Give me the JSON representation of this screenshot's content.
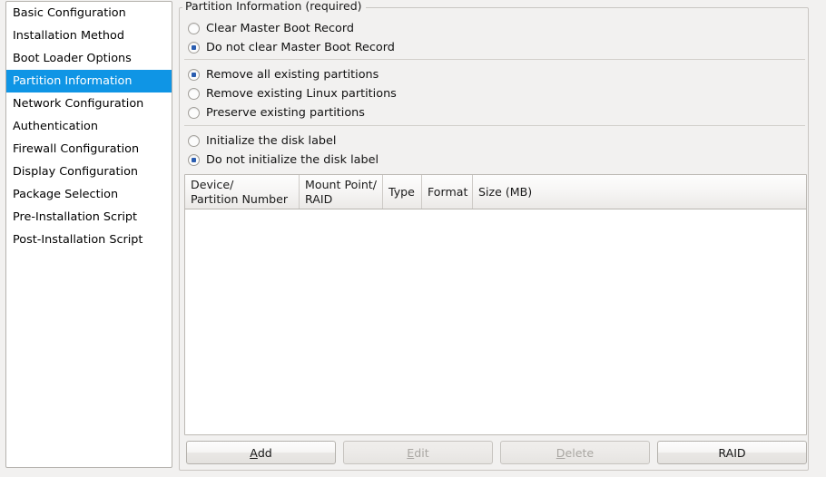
{
  "sidebar": {
    "items": [
      {
        "label": "Basic Configuration",
        "selected": false
      },
      {
        "label": "Installation Method",
        "selected": false
      },
      {
        "label": "Boot Loader Options",
        "selected": false
      },
      {
        "label": "Partition Information",
        "selected": true
      },
      {
        "label": "Network Configuration",
        "selected": false
      },
      {
        "label": "Authentication",
        "selected": false
      },
      {
        "label": "Firewall Configuration",
        "selected": false
      },
      {
        "label": "Display Configuration",
        "selected": false
      },
      {
        "label": "Package Selection",
        "selected": false
      },
      {
        "label": "Pre-Installation Script",
        "selected": false
      },
      {
        "label": "Post-Installation Script",
        "selected": false
      }
    ]
  },
  "panel": {
    "title": "Partition Information (required)",
    "mbr_group": {
      "options": [
        {
          "label": "Clear Master Boot Record",
          "checked": false
        },
        {
          "label": "Do not clear Master Boot Record",
          "checked": true
        }
      ]
    },
    "partition_group": {
      "options": [
        {
          "label": "Remove all existing partitions",
          "checked": true
        },
        {
          "label": "Remove existing Linux partitions",
          "checked": false
        },
        {
          "label": "Preserve existing partitions",
          "checked": false
        }
      ]
    },
    "disklabel_group": {
      "options": [
        {
          "label": "Initialize the disk label",
          "checked": false
        },
        {
          "label": "Do not initialize the disk label",
          "checked": true
        }
      ]
    },
    "table": {
      "columns": [
        {
          "line1": "Device/",
          "line2": "Partition Number"
        },
        {
          "line1": "Mount Point/",
          "line2": "RAID"
        },
        {
          "line1": "Type",
          "line2": ""
        },
        {
          "line1": "Format",
          "line2": ""
        },
        {
          "line1": "Size (MB)",
          "line2": ""
        }
      ],
      "rows": []
    },
    "buttons": [
      {
        "mnemonic": "A",
        "rest": "dd",
        "enabled": true
      },
      {
        "mnemonic": "E",
        "rest": "dit",
        "enabled": false
      },
      {
        "mnemonic": "D",
        "rest": "elete",
        "enabled": false
      },
      {
        "mnemonic": "",
        "rest": "RAID",
        "enabled": true
      }
    ]
  },
  "colors": {
    "selection": "#0f95e5",
    "radio_dot": "#2a5db0",
    "window_bg": "#f2f1f0"
  }
}
